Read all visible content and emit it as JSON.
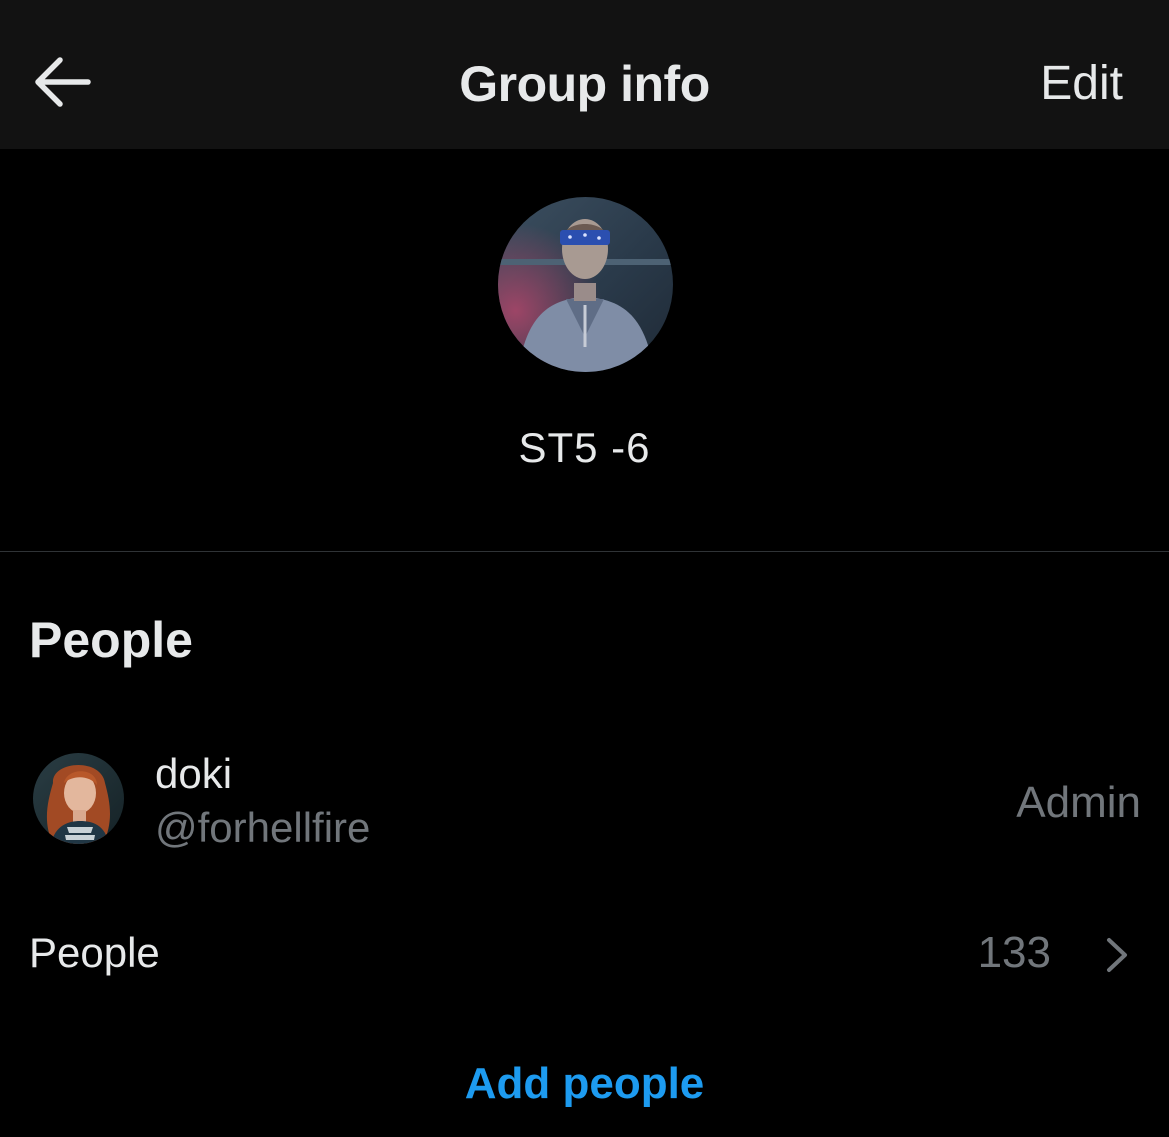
{
  "header": {
    "back_icon": "arrow-left-icon",
    "title": "Group info",
    "edit_label": "Edit"
  },
  "group": {
    "name": "ST5 -6",
    "avatar": "group-avatar-image"
  },
  "people_section": {
    "title": "People",
    "members": [
      {
        "name": "doki",
        "handle": "@forhellfire",
        "role": "Admin"
      }
    ],
    "people_row_label": "People",
    "people_count": "133",
    "chevron_icon": "chevron-right-icon",
    "add_people_label": "Add people"
  },
  "colors": {
    "background": "#000000",
    "header_background": "#121212",
    "primary_text": "#e7e9ea",
    "secondary_text": "#71767b",
    "accent": "#1d9bf0",
    "divider": "#2f3336"
  }
}
